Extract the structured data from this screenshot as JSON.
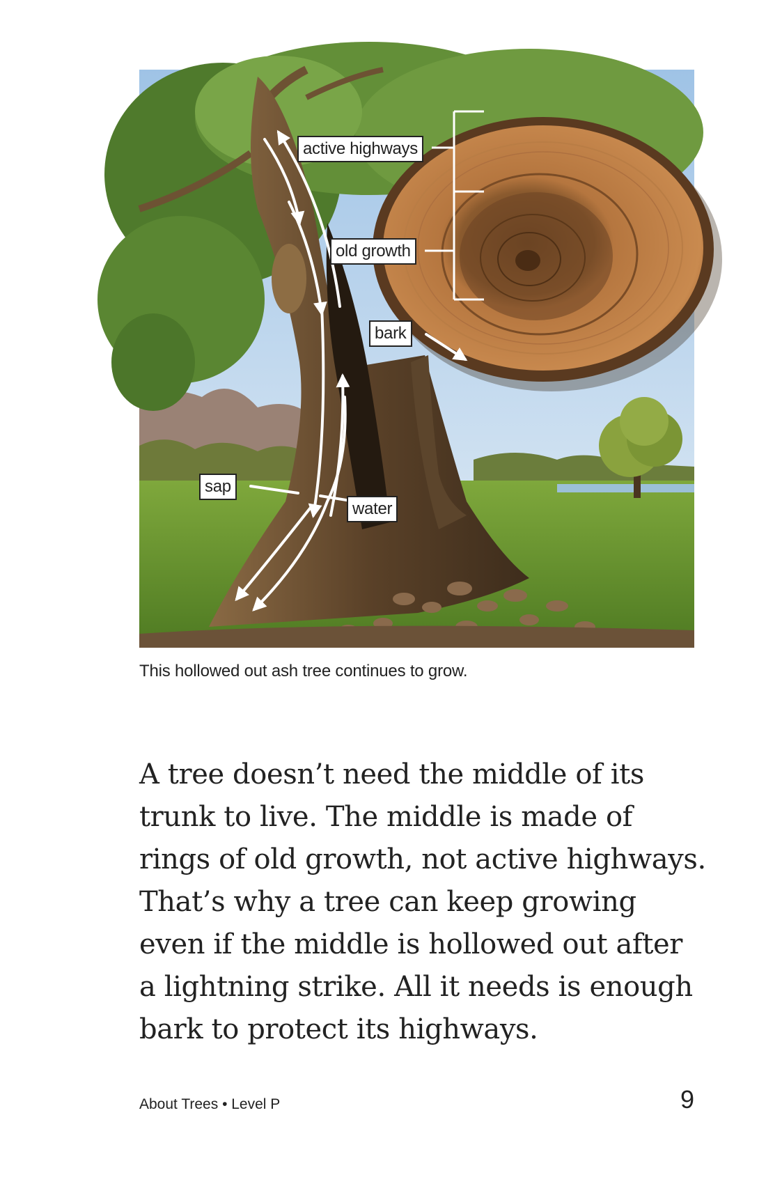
{
  "figure": {
    "labels": {
      "active_highways": "active highways",
      "old_growth": "old growth",
      "bark": "bark",
      "sap": "sap",
      "water": "water"
    },
    "caption": "This hollowed out ash tree continues to grow."
  },
  "body": {
    "lines": [
      "A tree doesn’t need the middle of its",
      "trunk to live. The middle is made of",
      "rings of old growth, not active highways.",
      "That’s why a tree can keep growing",
      "even if the middle is hollowed out after",
      "a lightning strike. All it needs is enough",
      "bark to protect its highways."
    ]
  },
  "footer": {
    "book": "About Trees • Level P",
    "page_number": "9"
  }
}
